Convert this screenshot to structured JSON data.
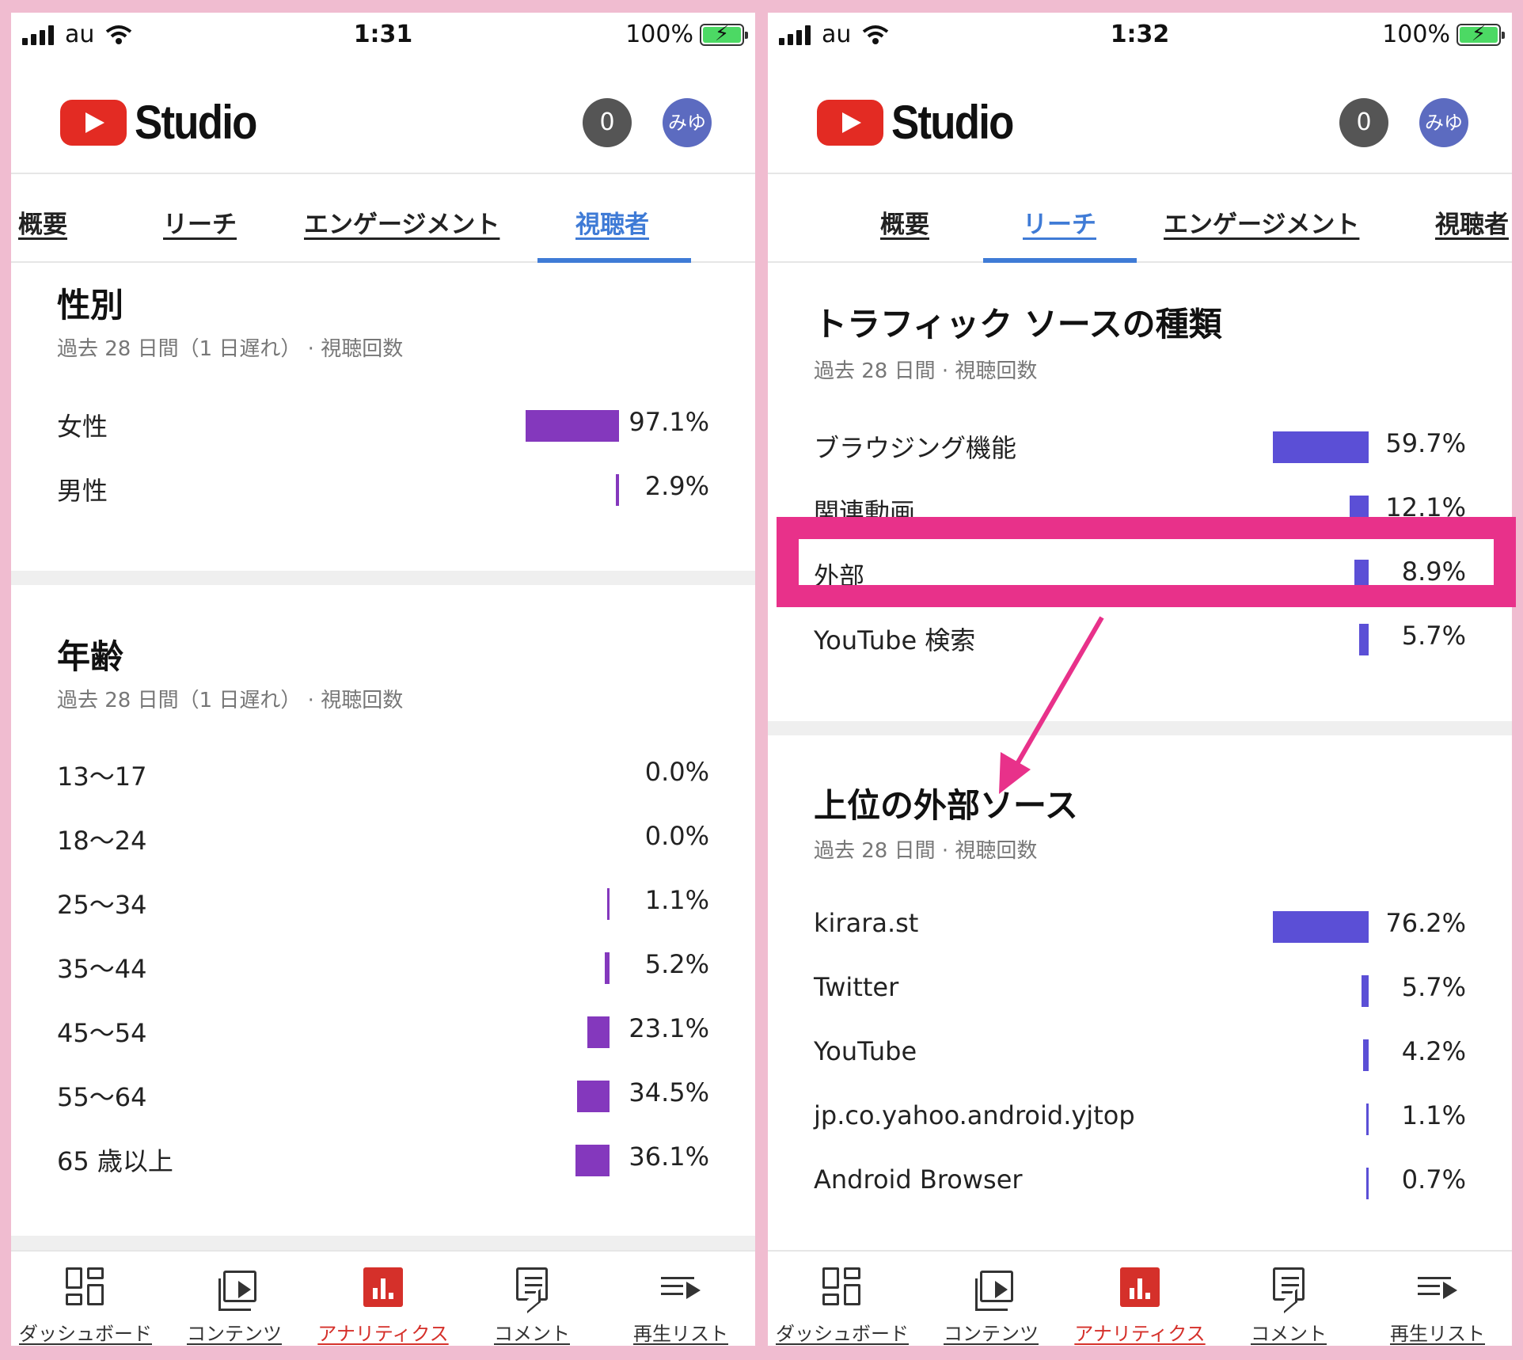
{
  "left": {
    "status": {
      "carrier": "au",
      "time": "1:31",
      "battery": "100%"
    },
    "header": {
      "app_name": "Studio",
      "notifications": "0",
      "avatar": "みゆ"
    },
    "tabs": [
      {
        "label": "概要",
        "active": false
      },
      {
        "label": "リーチ",
        "active": false
      },
      {
        "label": "エンゲージメント",
        "active": false
      },
      {
        "label": "視聴者",
        "active": true
      }
    ],
    "gender": {
      "title": "性別",
      "subtitle": "過去 28 日間（1 日遅れ） · 視聴回数",
      "rows": [
        {
          "label": "女性",
          "value": "97.1%",
          "pct": 97.1
        },
        {
          "label": "男性",
          "value": "2.9%",
          "pct": 2.9
        }
      ]
    },
    "age": {
      "title": "年齢",
      "subtitle": "過去 28 日間（1 日遅れ） · 視聴回数",
      "rows": [
        {
          "label": "13〜17",
          "value": "0.0%",
          "pct": 0.0
        },
        {
          "label": "18〜24",
          "value": "0.0%",
          "pct": 0.0
        },
        {
          "label": "25〜34",
          "value": "1.1%",
          "pct": 1.1
        },
        {
          "label": "35〜44",
          "value": "5.2%",
          "pct": 5.2
        },
        {
          "label": "45〜54",
          "value": "23.1%",
          "pct": 23.1
        },
        {
          "label": "55〜64",
          "value": "34.5%",
          "pct": 34.5
        },
        {
          "label": "65 歳以上",
          "value": "36.1%",
          "pct": 36.1
        }
      ]
    }
  },
  "right": {
    "status": {
      "carrier": "au",
      "time": "1:32",
      "battery": "100%"
    },
    "header": {
      "app_name": "Studio",
      "notifications": "0",
      "avatar": "みゆ"
    },
    "tabs": [
      {
        "label": "概要",
        "active": false
      },
      {
        "label": "リーチ",
        "active": true
      },
      {
        "label": "エンゲージメント",
        "active": false
      },
      {
        "label": "視聴者",
        "active": false
      }
    ],
    "traffic": {
      "title": "トラフィック ソースの種類",
      "subtitle": "過去 28 日間 · 視聴回数",
      "rows": [
        {
          "label": "ブラウジング機能",
          "value": "59.7%",
          "pct": 59.7
        },
        {
          "label": "関連動画",
          "value": "12.1%",
          "pct": 12.1
        },
        {
          "label": "外部",
          "value": "8.9%",
          "pct": 8.9
        },
        {
          "label": "YouTube 検索",
          "value": "5.7%",
          "pct": 5.7
        }
      ]
    },
    "external": {
      "title": "上位の外部ソース",
      "subtitle": "過去 28 日間 · 視聴回数",
      "rows": [
        {
          "label": "kirara.st",
          "value": "76.2%",
          "pct": 76.2
        },
        {
          "label": "Twitter",
          "value": "5.7%",
          "pct": 5.7
        },
        {
          "label": "YouTube",
          "value": "4.2%",
          "pct": 4.2
        },
        {
          "label": "jp.co.yahoo.android.yjtop",
          "value": "1.1%",
          "pct": 1.1
        },
        {
          "label": "Android Browser",
          "value": "0.7%",
          "pct": 0.7
        }
      ]
    }
  },
  "bottom_nav": [
    {
      "label": "ダッシュボード",
      "icon": "dashboard-icon",
      "active": false
    },
    {
      "label": "コンテンツ",
      "icon": "content-icon",
      "active": false
    },
    {
      "label": "アナリティクス",
      "icon": "analytics-icon",
      "active": true
    },
    {
      "label": "コメント",
      "icon": "comment-icon",
      "active": false
    },
    {
      "label": "再生リスト",
      "icon": "playlist-icon",
      "active": false
    }
  ],
  "colors": {
    "accent": "#3f7bd6",
    "bar_audience": "#8438bd",
    "bar_reach": "#5b4fd6",
    "highlight": "#e8318a",
    "brand_red": "#e32b23"
  }
}
